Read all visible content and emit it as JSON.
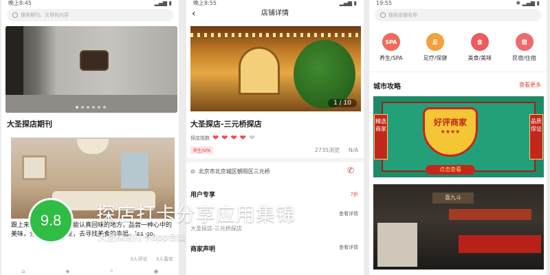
{
  "phone1": {
    "status_time": "晚上8:45",
    "search_placeholder": "搜索期刊、文章和内容",
    "section_title": "大圣探店期刊",
    "article_text": "跟上来！在你离开后还能认真回味的地方，品尝一种心中的美味，分享给亲朋好友，去寻找美食的幸福。les go。",
    "likes": "3人评论",
    "favs": "3人喜欢"
  },
  "phone2": {
    "status_time": "晚上8:55",
    "nav_title": "店铺详情",
    "image_counter": "1 / 10",
    "shop_name": "大圣探店-三元桥探店",
    "rating_label": "探店指数",
    "tag": "养生/SPA",
    "views": "2735浏览",
    "distance": "N/A",
    "address": "北京市北京城区朝阳区三元桥",
    "section_user": "用户专享",
    "user_count": "7折",
    "sub_shop": "大圣探店-三元桥探店",
    "detail_link": "查看详情",
    "section_merchant": "商家声明"
  },
  "phone3": {
    "status_time": "19:55",
    "search_placeholder": "搜索店铺名称",
    "categories": [
      {
        "label": "养生/SPA",
        "icon": "SPA",
        "color": "#f06a5a"
      },
      {
        "label": "足疗/保健",
        "icon": "足",
        "color": "#f5a03c"
      },
      {
        "label": "美食/美味",
        "icon": "食",
        "color": "#ef5a5a"
      },
      {
        "label": "民宿/住宿",
        "icon": "宿",
        "color": "#ef6a6a"
      }
    ],
    "guide_title": "城市攻略",
    "guide_more": "查看更多",
    "banner_left": "精选商家",
    "banner_right": "品质保证",
    "banner_main": "好评商家",
    "banner_stars": "★★★★",
    "banner_cta": "点击查看",
    "shop_sign": "喜九斗"
  },
  "overlay": {
    "score": "9.8",
    "title": "探店打卡分享应用集锦",
    "subtitle": "大圣探店打卡app合集"
  }
}
